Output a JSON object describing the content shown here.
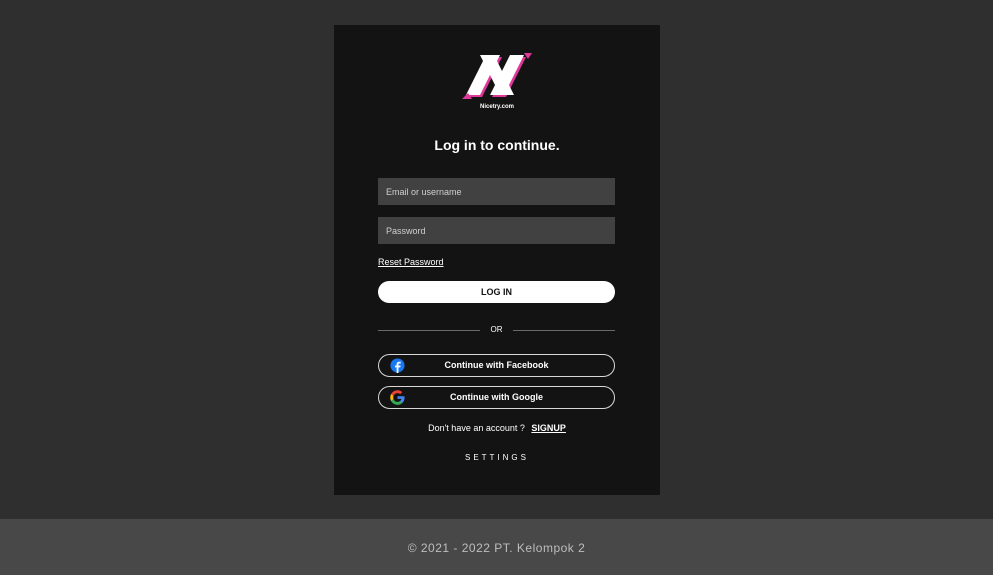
{
  "brand": {
    "name": "Nicetry.com",
    "accent_color": "#e0389a"
  },
  "login": {
    "heading": "Log in to continue.",
    "email_placeholder": "Email or username",
    "password_placeholder": "Password",
    "reset_label": "Reset Password",
    "login_label": "LOG IN",
    "or_label": "OR",
    "facebook_label": "Continue with Facebook",
    "google_label": "Continue with Google",
    "signup_prompt": "Don't have an account ?",
    "signup_label": "SIGNUP",
    "settings_label": "SETTINGS"
  },
  "footer": {
    "text": "© 2021 - 2022 PT. Kelompok 2"
  },
  "icons": {
    "facebook": "facebook-icon",
    "google": "google-icon",
    "logo": "nicetry-logo-icon"
  }
}
